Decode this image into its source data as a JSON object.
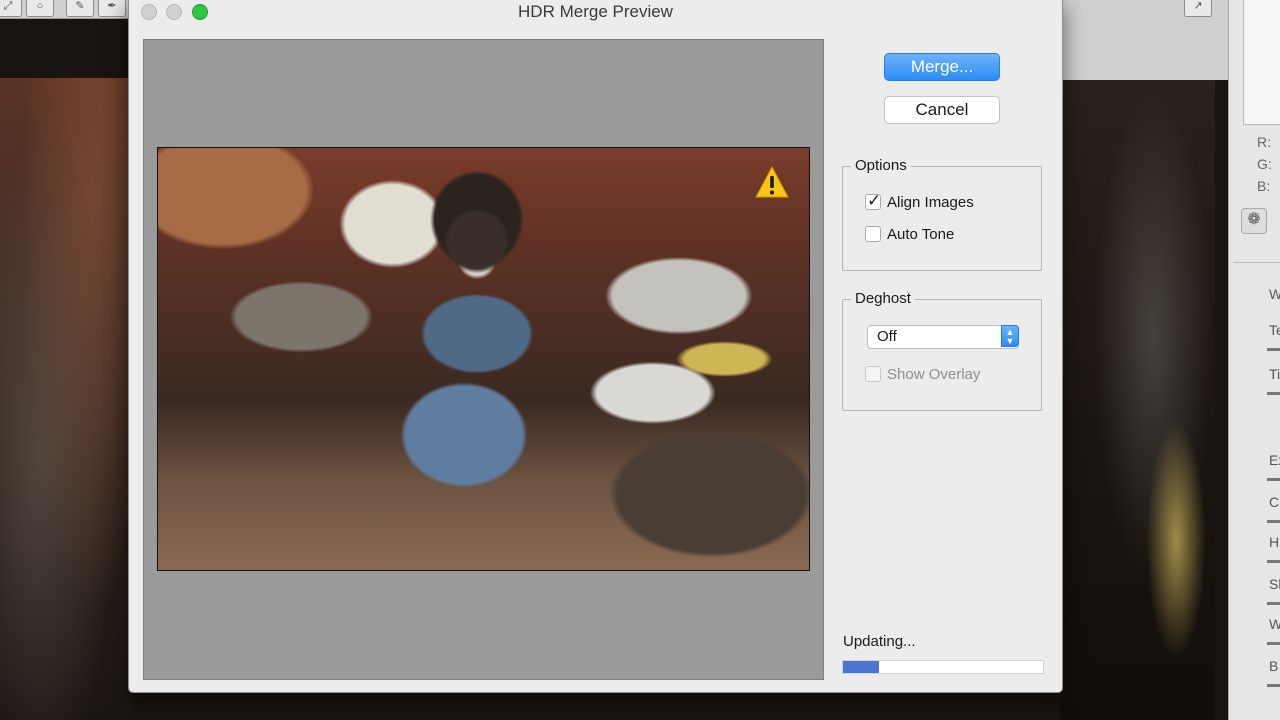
{
  "dialog": {
    "title": "HDR Merge Preview",
    "merge_label": "Merge...",
    "cancel_label": "Cancel",
    "status_text": "Updating...",
    "progress": 0.18,
    "accent_color": "#2c8cf4"
  },
  "options": {
    "title": "Options",
    "align_images": {
      "label": "Align Images",
      "checked": true
    },
    "auto_tone": {
      "label": "Auto Tone",
      "checked": false
    }
  },
  "deghost": {
    "title": "Deghost",
    "selected": "Off",
    "show_overlay": {
      "label": "Show Overlay",
      "checked": false,
      "enabled": false
    }
  },
  "background_panel": {
    "rgb_labels": [
      "R:",
      "G:",
      "B:"
    ],
    "slider_labels": [
      "W",
      "Te",
      "Ti",
      "Ex",
      "C",
      "H",
      "Sl",
      "W",
      "B"
    ]
  },
  "icons": {
    "warning": "warning-triangle-icon",
    "select_arrows": "up-down-chevron-icon"
  }
}
